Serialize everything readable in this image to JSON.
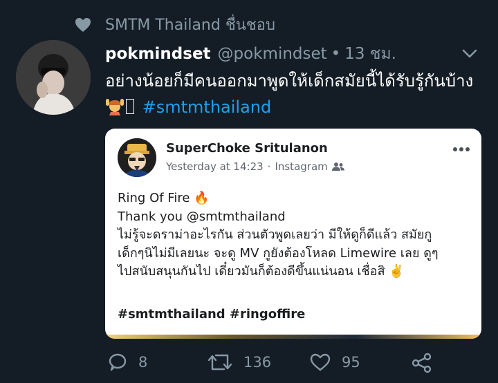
{
  "social_context": {
    "text": "SMTM Thailand ชื่นชอบ",
    "icon": "heart-icon"
  },
  "tweet": {
    "display_name": "pokmindset",
    "handle": "@pokmindset",
    "separator": "•",
    "time": "13 ชม.",
    "text": "อย่างน้อยก็มีคนออกมาพูดให้เด็กสมัยนี้ได้รับรู้กันบ้าง",
    "hashtag": "#smtmthailand"
  },
  "embedded_post": {
    "author": "SuperChoke Sritulanon",
    "date": "Yesterday at 14:23",
    "meta_sep": "·",
    "source": "Instagram",
    "body": "Ring Of Fire 🔥\nThank you @smtmthailand\nไม่รู้จะดราม่าอะไรกัน ส่วนตัวพูดเลยว่า มีให้ดูก็ดีแล้ว สมัยกู\nเด็กๆนิไม่มีเลยนะ จะดู MV กูยังต้องโหลด Limewire เลย ดูๆ\nไปสนับสนุนกันไป เดี๋ยวมันก็ต้องดีขึ้นแน่นอน เชื่อสิ ✌️",
    "tags": "#smtmthailand #ringoffire"
  },
  "actions": {
    "replies": "8",
    "retweets": "136",
    "likes": "95"
  },
  "colors": {
    "background": "#141d26",
    "secondary_text": "#8899a6",
    "hashtag": "#1da1f2",
    "card_bg": "#ffffff"
  }
}
